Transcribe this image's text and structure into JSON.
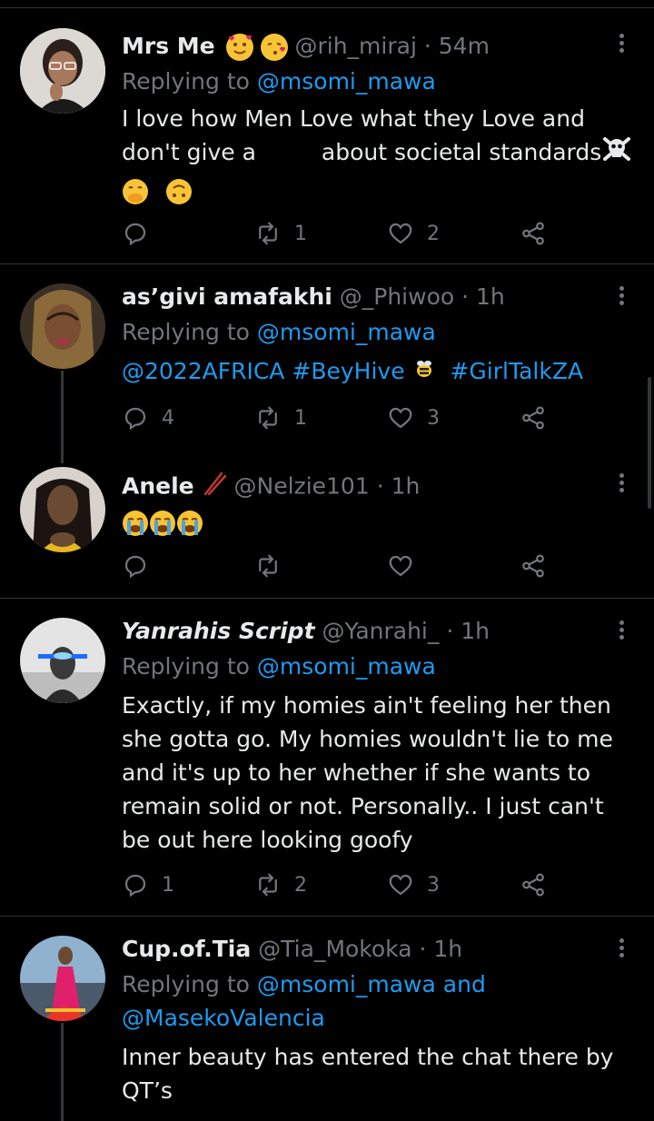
{
  "tweets": [
    {
      "name": "Mrs Me",
      "name_emojis": [
        "smiling-face-with-hearts",
        "face-blowing-kiss"
      ],
      "handle": "@rih_miraj",
      "separator": "·",
      "time": "54m",
      "replying_prefix": "Replying to",
      "replying_to": "@msomi_mawa",
      "body_line1": "I love how Men Love what they Love and",
      "body_line2_a": "don't give a",
      "body_line2_b": "about societal standards",
      "body_emojis": [
        "face-with-hand-over-mouth",
        "upside-down-face"
      ],
      "replies": "",
      "retweets": "1",
      "likes": "2"
    },
    {
      "name": "as’givi amafakhi",
      "handle": "@_Phiwoo",
      "separator": "·",
      "time": "1h",
      "replying_prefix": "Replying to",
      "replying_to": "@msomi_mawa",
      "tags": [
        "@2022AFRICA",
        "#BeyHive",
        "#GirlTalkZA"
      ],
      "replies": "4",
      "retweets": "1",
      "likes": "3"
    },
    {
      "name": "Anele",
      "handle": "@Nelzie101",
      "separator": "·",
      "time": "1h",
      "body_emojis": [
        "loudly-crying-face",
        "loudly-crying-face",
        "loudly-crying-face"
      ],
      "replies": "",
      "retweets": "",
      "likes": ""
    },
    {
      "name": "Yanrahis Script",
      "handle": "@Yanrahi_",
      "separator": "·",
      "time": "1h",
      "replying_prefix": "Replying to",
      "replying_to": "@msomi_mawa",
      "body_lines": [
        "Exactly, if my homies ain't feeling her then",
        "she gotta go. My homies wouldn't lie to me",
        "and it's up to her whether if she wants to",
        "remain solid or not. Personally.. I just can't",
        "be out here looking goofy"
      ],
      "replies": "1",
      "retweets": "2",
      "likes": "3"
    },
    {
      "name": "Cup.of.Tia",
      "handle": "@Tia_Mokoka",
      "separator": "·",
      "time": "1h",
      "replying_prefix": "Replying to",
      "replying_to": "@msomi_mawa",
      "replying_and": "and",
      "replying_to2": "@MasekoValencia",
      "body_lines": [
        "Inner beauty has entered the chat there by",
        "QT’s"
      ]
    }
  ],
  "colors": {
    "background": "#000000",
    "text": "#e7e9ea",
    "muted": "#71767b",
    "link": "#1d9bf0",
    "divider": "#2f3336"
  }
}
